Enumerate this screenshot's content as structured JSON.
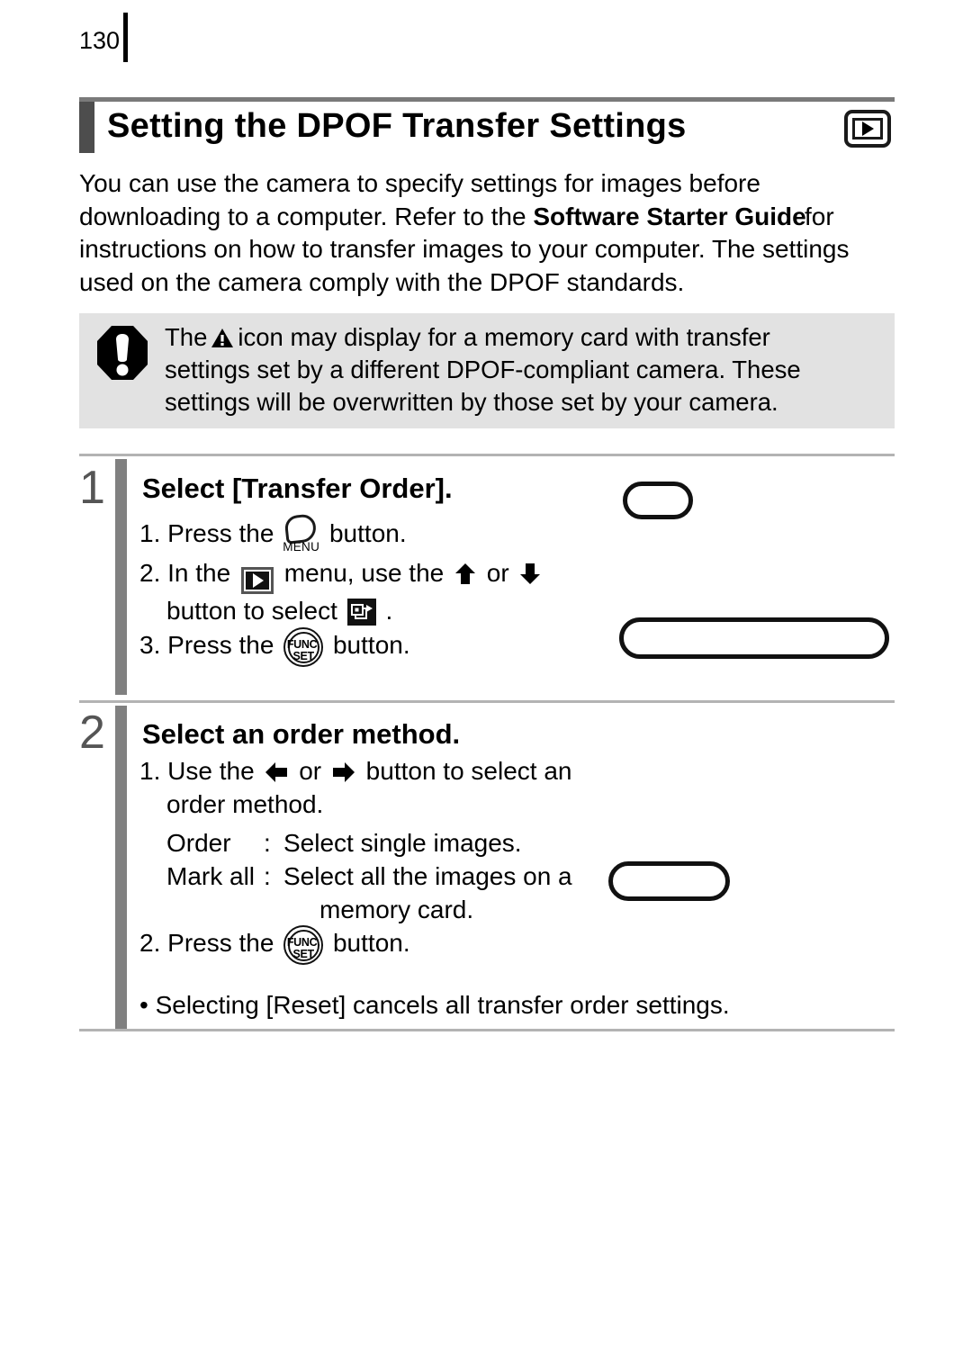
{
  "page": {
    "number": "130"
  },
  "header": {
    "title": "Setting the DPOF Transfer Settings",
    "icon": "playback-mode-icon"
  },
  "intro": {
    "lines": [
      "You can use the camera to specify settings for images before",
      "downloading to a computer. Refer to the ",
      "instructions on how to transfer images to your computer. The settings",
      "used on the camera comply with the DPOF standards."
    ],
    "bold_phrase": "Software Starter Guide",
    "overlap_word": "for"
  },
  "note": {
    "icon": "exclamation-octagon-icon",
    "inline_icon": "warning-triangle-icon",
    "line1_a": "The",
    "line1_b": "icon may display for a memory card with transfer",
    "line2": "settings set by a different DPOF-compliant camera. These",
    "line3": "settings will be overwritten by those set by your camera."
  },
  "steps": [
    {
      "number": "1",
      "heading": "Select [Transfer Order].",
      "items": [
        {
          "num": "1.",
          "a": "Press the",
          "icon": "menu-button-icon",
          "b": "button."
        },
        {
          "num": "2.",
          "a": "In the",
          "icon": "playback-menu-tab-icon",
          "b": "menu, use the",
          "arrow_up": "↑",
          "or": "or",
          "arrow_down": "↓"
        },
        {
          "cont": "button to select",
          "icon": "transfer-order-icon",
          "end": "."
        },
        {
          "num": "3.",
          "a": "Press the",
          "icon": "func-set-button-icon",
          "b": "button."
        }
      ]
    },
    {
      "number": "2",
      "heading": "Select an order method.",
      "items": [
        {
          "num": "1.",
          "a": "Use the",
          "arrow_left": "←",
          "or": "or",
          "arrow_right": "→",
          "b": "button to select an"
        },
        {
          "cont": "order method."
        }
      ],
      "options": [
        {
          "label": "Order",
          "sep": ":",
          "desc": "Select single images."
        },
        {
          "label": "Mark all",
          "sep": ":",
          "desc": "Select all the images on a"
        },
        {
          "label": "",
          "sep": "",
          "desc": "memory card."
        }
      ],
      "final": {
        "num": "2.",
        "a": "Press the",
        "icon": "func-set-button-icon",
        "b": "button."
      }
    }
  ],
  "bullet": "• Selecting [Reset] cancels all transfer order settings.",
  "func_button": {
    "top_label": "FUNC.",
    "bottom_label": "SET"
  },
  "menu_button": {
    "label": "MENU"
  },
  "colors": {
    "title_tab": "#4d4d4d",
    "step_bar": "#808080",
    "step_number": "#555555",
    "note_bg": "#e2e2e2",
    "rule": "#b3b3b3"
  }
}
